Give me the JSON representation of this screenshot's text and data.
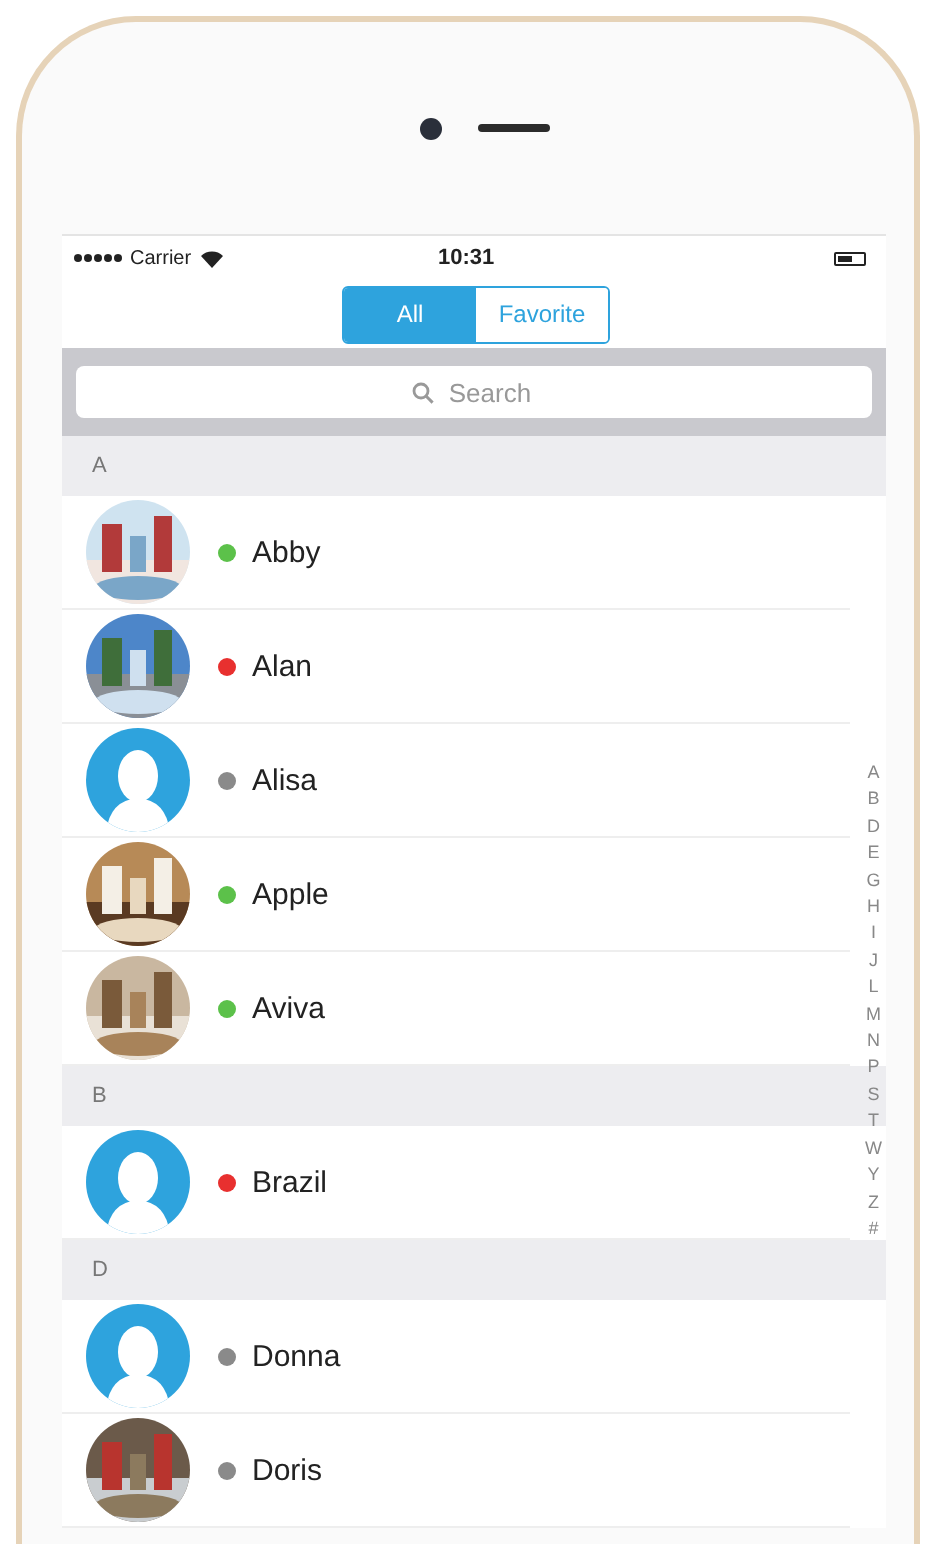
{
  "status_bar": {
    "carrier": "Carrier",
    "time": "10:31"
  },
  "segments": [
    {
      "label": "All",
      "selected": true
    },
    {
      "label": "Favorite",
      "selected": false
    }
  ],
  "search": {
    "placeholder": "Search"
  },
  "sections": [
    {
      "letter": "A",
      "contacts": [
        {
          "name": "Abby",
          "color": "#5cc14a"
        },
        {
          "name": "Alan",
          "color": "#e8302f"
        },
        {
          "name": "Alisa",
          "color": "#8a8a8a",
          "kind": "default"
        },
        {
          "name": "Apple",
          "color": "#5cc14a"
        },
        {
          "name": "Aviva",
          "color": "#5cc14a"
        }
      ]
    },
    {
      "letter": "B",
      "contacts": [
        {
          "name": "Brazil",
          "color": "#e8302f",
          "kind": "default"
        }
      ]
    },
    {
      "letter": "D",
      "contacts": [
        {
          "name": "Donna",
          "color": "#8a8a8a",
          "kind": "default"
        },
        {
          "name": "Doris",
          "color": "#8a8a8a"
        }
      ]
    }
  ],
  "index": [
    "A",
    "B",
    "D",
    "E",
    "G",
    "H",
    "I",
    "J",
    "L",
    "M",
    "N",
    "P",
    "S",
    "T",
    "W",
    "Y",
    "Z",
    "#"
  ]
}
